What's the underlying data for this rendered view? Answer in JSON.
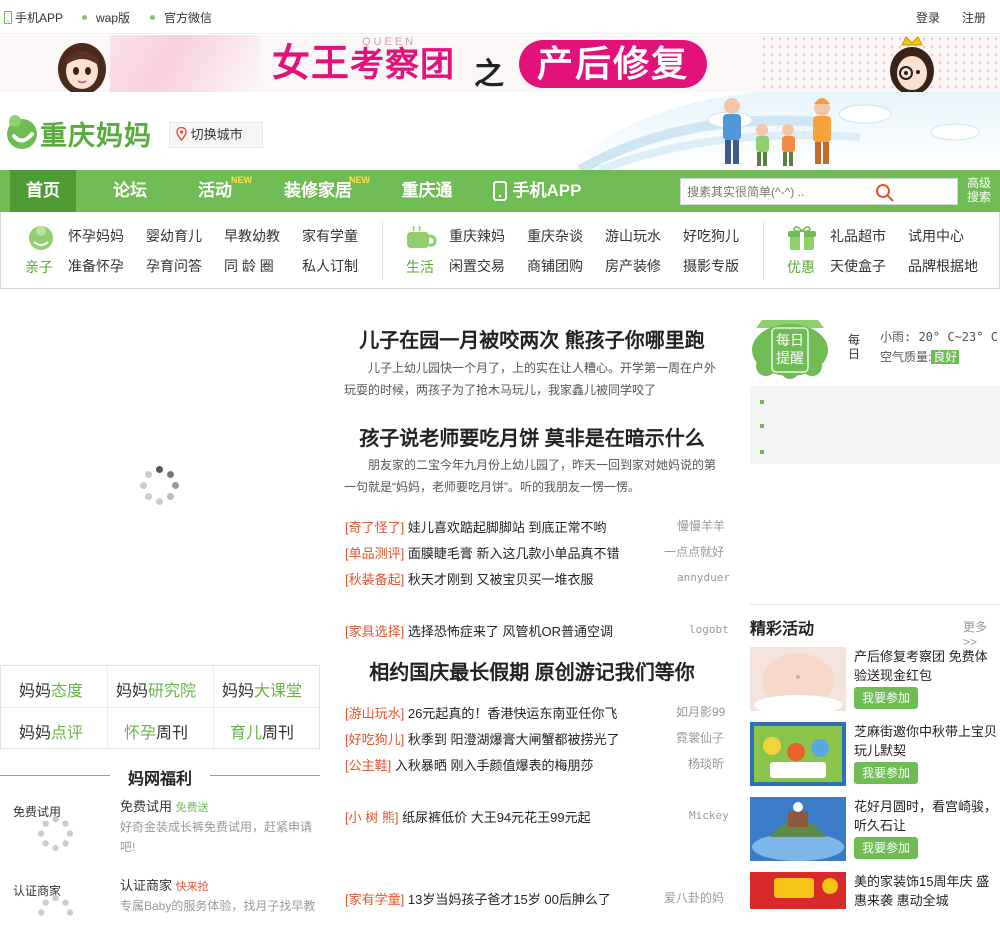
{
  "topbar": {
    "mobile_app": "手机APP",
    "wap": "wap版",
    "wechat": "官方微信",
    "login": "登录",
    "register": "注册"
  },
  "banner": {
    "queen_char": "女王",
    "queen_rest": "考察团",
    "queen_en": "QUEEN",
    "zhi": "之",
    "postpartum": "产后修复"
  },
  "header": {
    "logo_text": "重庆妈妈",
    "switch_city": "切换城市"
  },
  "nav": {
    "items": [
      "首页",
      "论坛",
      "活动",
      "装修家居",
      "重庆通",
      "手机APP"
    ],
    "new_badge": "NEW",
    "search_placeholder": "搜素其实很简单(^-^) ..",
    "advanced_search_1": "高级",
    "advanced_search_2": "搜索"
  },
  "subnav": {
    "groups": [
      {
        "category": "亲子",
        "row1": [
          "怀孕妈妈",
          "婴幼育儿",
          "早教幼教",
          "家有学童"
        ],
        "row2": [
          "准备怀孕",
          "孕育问答",
          "同 龄 圈",
          "私人订制"
        ]
      },
      {
        "category": "生活",
        "row1": [
          "重庆辣妈",
          "重庆杂谈",
          "游山玩水",
          "好吃狗儿"
        ],
        "row2": [
          "闲置交易",
          "商铺团购",
          "房产装修",
          "摄影专版"
        ]
      },
      {
        "category": "优惠",
        "row1": [
          "礼品超市",
          "试用中心"
        ],
        "row2": [
          "天使盒子",
          "品牌根据地"
        ]
      }
    ]
  },
  "left": {
    "grid": [
      [
        {
          "a": "妈妈",
          "b": "态度"
        },
        {
          "a": "妈妈",
          "b": "研究院"
        },
        {
          "a": "妈妈",
          "b": "大课堂"
        }
      ],
      [
        {
          "a": "妈妈",
          "b": "点评"
        },
        {
          "a": "怀孕",
          "b": "周刊"
        },
        {
          "a": "育儿",
          "b": "周刊"
        }
      ]
    ],
    "welfare_title": "妈网福利",
    "welfare": [
      {
        "img_alt": "免费试用",
        "title": "免费试用",
        "badge": "免费送",
        "desc": "好奇金装成长裤免费试用，赶紧申请吧!"
      },
      {
        "img_alt": "认证商家",
        "title": "认证商家",
        "badge": "快来抢",
        "desc": "专属Baby的服务体验，找月子找早教"
      }
    ]
  },
  "center": {
    "head1": {
      "title": "儿子在园一月被咬两次 熊孩子你哪里跑",
      "text": "儿子上幼儿园快一个月了，上的实在让人糟心。开学第一周在户外玩耍的时候，两孩子为了抢木马玩儿，我家鑫儿被同学咬了"
    },
    "head2": {
      "title": "孩子说老师要吃月饼 莫非是在暗示什么",
      "text": "朋友家的二宝今年九月份上幼儿园了，昨天一回到家对她妈说的第一句就是“妈妈，老师要吃月饼”。听的我朋友一愣一愣。"
    },
    "list1": [
      {
        "tag": "[奇了怪了]",
        "text": "娃儿喜欢踮起脚脚站 到底正常不哟",
        "author": "慢慢羊羊"
      },
      {
        "tag": "[单品测评]",
        "text": "面膜睫毛膏 新入这几款小单品真不错",
        "author": "一点点就好"
      },
      {
        "tag": "[秋装备起]",
        "text": "秋天才刚到 又被宝贝买一堆衣服",
        "author": "annyduer"
      }
    ],
    "list1b": {
      "tag": "[家具选择]",
      "text": "选择恐怖症来了 风管机OR普通空调",
      "author": "logobt"
    },
    "head3": {
      "title": "相约国庆最长假期 原创游记我们等你"
    },
    "list2": [
      {
        "tag": "[游山玩水]",
        "text": "26元起真的！香港快运东南亚任你飞",
        "author": "如月影99"
      },
      {
        "tag": "[好吃狗儿]",
        "text": "秋季到 阳澄湖爆膏大闸蟹都被捞光了",
        "author": "霓裳仙子"
      },
      {
        "tag": "[公主鞋]",
        "text": "入秋暴晒 刚入手颜值爆表的梅朋莎",
        "author": "杨琰昕"
      }
    ],
    "list2b": {
      "tag": "[小 树 熊]",
      "text": "纸尿裤低价 大王94元花王99元起",
      "author": "Mickey"
    },
    "list3": {
      "tag": "[家有学童]",
      "text": "13岁当妈孩子爸才15岁 00后胂么了",
      "author": "爱八卦的妈"
    }
  },
  "right": {
    "daily_1": "每日",
    "daily_2": "提醒",
    "day_1": "每",
    "day_2": "日",
    "weather": "小雨: 20° C~23° C",
    "air_label": "空气质量:",
    "air_value": "良好",
    "activities_title": "精彩活动",
    "more": "更多>>",
    "activities": [
      {
        "title": "产后修复考察团 免费体验送现金红包",
        "button": "我要参加"
      },
      {
        "title": "芝麻街邀你中秋带上宝贝玩儿默契",
        "button": "我要参加"
      },
      {
        "title": "花好月圆时，看宫崎骏，听久石让",
        "button": "我要参加"
      },
      {
        "title": "美的家装饰15周年庆 盛惠来袭 惠动全城",
        "button": ""
      }
    ]
  },
  "colors": {
    "green": "#6fbb54",
    "tag_red": "#e1542f",
    "brand_pink": "#e2127a"
  }
}
